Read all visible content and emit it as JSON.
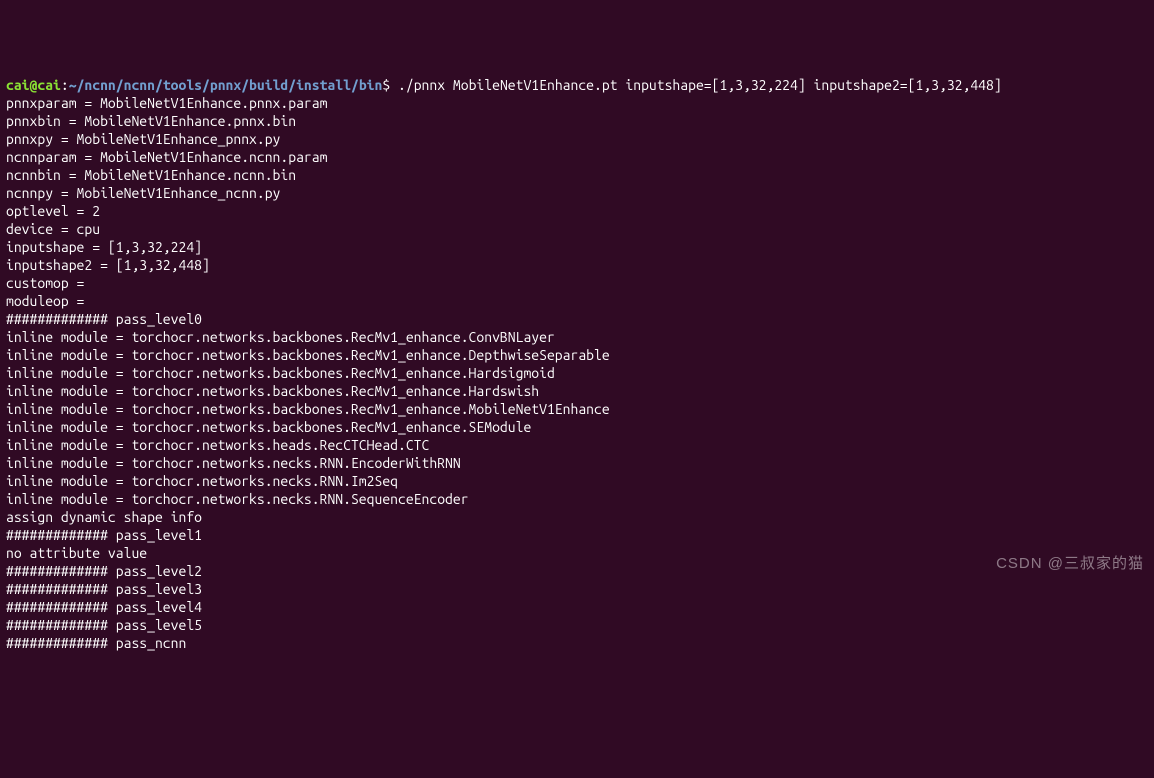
{
  "prompt": {
    "user": "cai@cai",
    "colon": ":",
    "path": "~/ncnn/ncnn/tools/pnnx/build/install/bin",
    "dollar": "$",
    "command": " ./pnnx MobileNetV1Enhance.pt inputshape=[1,3,32,224] inputshape2=[1,3,32,448]"
  },
  "lines": {
    "l0": "pnnxparam = MobileNetV1Enhance.pnnx.param",
    "l1": "pnnxbin = MobileNetV1Enhance.pnnx.bin",
    "l2": "pnnxpy = MobileNetV1Enhance_pnnx.py",
    "l3": "ncnnparam = MobileNetV1Enhance.ncnn.param",
    "l4": "ncnnbin = MobileNetV1Enhance.ncnn.bin",
    "l5": "ncnnpy = MobileNetV1Enhance_ncnn.py",
    "l6": "optlevel = 2",
    "l7": "device = cpu",
    "l8": "inputshape = [1,3,32,224]",
    "l9": "inputshape2 = [1,3,32,448]",
    "l10": "customop =",
    "l11": "moduleop =",
    "l12": "############# pass_level0",
    "l13": "inline module = torchocr.networks.backbones.RecMv1_enhance.ConvBNLayer",
    "l14": "inline module = torchocr.networks.backbones.RecMv1_enhance.DepthwiseSeparable",
    "l15": "inline module = torchocr.networks.backbones.RecMv1_enhance.Hardsigmoid",
    "l16": "inline module = torchocr.networks.backbones.RecMv1_enhance.Hardswish",
    "l17": "inline module = torchocr.networks.backbones.RecMv1_enhance.MobileNetV1Enhance",
    "l18": "inline module = torchocr.networks.backbones.RecMv1_enhance.SEModule",
    "l19": "inline module = torchocr.networks.heads.RecCTCHead.CTC",
    "l20": "inline module = torchocr.networks.necks.RNN.EncoderWithRNN",
    "l21": "inline module = torchocr.networks.necks.RNN.Im2Seq",
    "l22": "inline module = torchocr.networks.necks.RNN.SequenceEncoder",
    "l23": "assign dynamic shape info",
    "l24": "############# pass_level1",
    "l25": "no attribute value",
    "l26": "############# pass_level2",
    "l27": "############# pass_level3",
    "l28": "############# pass_level4",
    "l29": "############# pass_level5",
    "l30": "############# pass_ncnn"
  },
  "watermark": "CSDN @三叔家的猫"
}
